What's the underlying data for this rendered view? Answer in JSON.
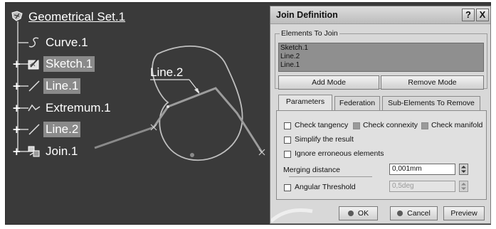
{
  "tree": {
    "root": "Geometrical Set.1",
    "items": [
      {
        "label": "Curve.1",
        "icon": "curve-icon"
      },
      {
        "label": "Sketch.1",
        "icon": "sketch-icon"
      },
      {
        "label": "Line.1",
        "icon": "line-icon"
      },
      {
        "label": "Extremum.1",
        "icon": "extremum-icon"
      },
      {
        "label": "Line.2",
        "icon": "line-icon"
      },
      {
        "label": "Join.1",
        "icon": "join-icon"
      }
    ]
  },
  "viewport": {
    "annotation": "Line.2"
  },
  "dialog": {
    "title": "Join Definition",
    "help_button": "?",
    "close_button": "X",
    "elements_group_title": "Elements To Join",
    "elements": [
      "Sketch.1",
      "Line.2",
      "Line.1"
    ],
    "add_mode_button": "Add Mode",
    "remove_mode_button": "Remove Mode",
    "tabs": [
      "Parameters",
      "Federation",
      "Sub-Elements To Remove"
    ],
    "options": {
      "check_tangency": "Check tangency",
      "check_connexity": "Check connexity",
      "check_manifold": "Check manifold",
      "simplify": "Simplify the result",
      "ignore_erroneous": "Ignore erroneous elements"
    },
    "merging_distance_label": "Merging distance",
    "merging_distance_value": "0,001mm",
    "angular_threshold_label": "Angular Threshold",
    "angular_threshold_value": "0,5deg",
    "ok_button": "OK",
    "cancel_button": "Cancel",
    "preview_button": "Preview"
  }
}
